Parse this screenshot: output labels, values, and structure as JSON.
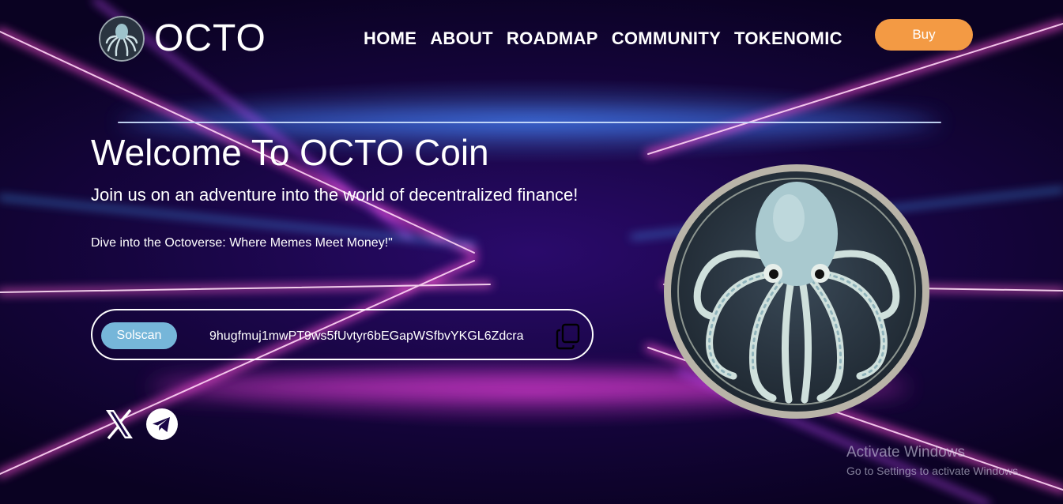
{
  "brand": {
    "name": "OCTO",
    "logo_icon": "octopus-logo-icon"
  },
  "nav": {
    "items": [
      {
        "label": "HOME"
      },
      {
        "label": "ABOUT"
      },
      {
        "label": "ROADMAP"
      },
      {
        "label": "COMMUNITY"
      },
      {
        "label": "TOKENOMIC"
      }
    ],
    "buy_label": "Buy"
  },
  "hero": {
    "title": "Welcome To OCTO Coin",
    "subtitle": "Join us on an adventure into the world of decentralized finance!",
    "tagline": "Dive into the Octoverse: Where Memes Meet Money!\""
  },
  "contract": {
    "button_label": "Solscan",
    "address": "9hugfmuj1mwPT9ws5fUvtyr6bEGapWSfbvYKGL6Zdcra",
    "copy_icon": "copy-icon"
  },
  "social": {
    "icons": [
      "x-twitter-icon",
      "telegram-icon"
    ]
  },
  "coin_image": "octopus-coin-illustration",
  "windows_notice": {
    "title": "Activate Windows",
    "text": "Go to Settings to activate Windows."
  },
  "colors": {
    "buy_button": "#f39a44",
    "solscan_button": "#76b6d9",
    "background": "#16053f",
    "ray_pink": "#ff4fd8",
    "ray_blue": "#4aa3ff"
  }
}
